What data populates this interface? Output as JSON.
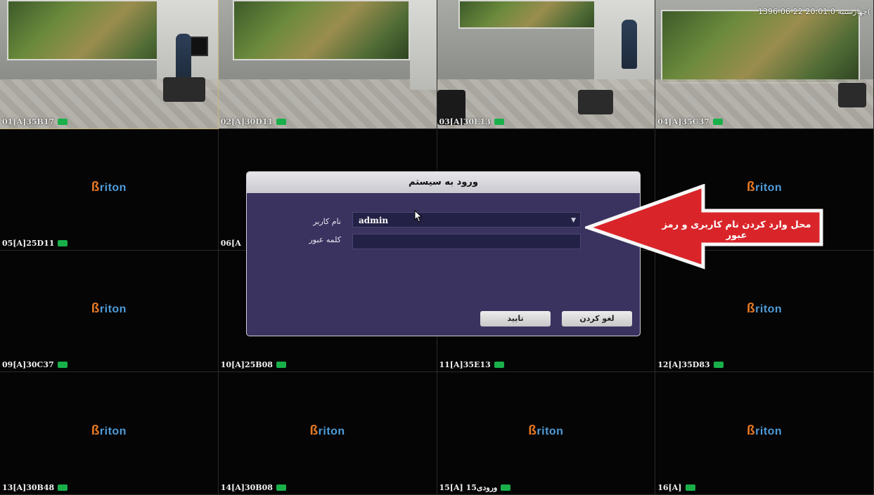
{
  "cameras": [
    {
      "id": "01[A]35B17",
      "feed": true,
      "selected": true
    },
    {
      "id": "02[A]30D11",
      "feed": true
    },
    {
      "id": "03[A]30E13",
      "feed": true
    },
    {
      "id": "04[A]35C37",
      "feed": true,
      "timestamp": "1396-06-22 چهارشنبه 20:01:0("
    },
    {
      "id": "05[A]25D11",
      "logo": "Briton"
    },
    {
      "id": "06[A",
      "logo": ""
    },
    {
      "id": "",
      "logo": ""
    },
    {
      "id": "",
      "logo": "Briton"
    },
    {
      "id": "09[A]30C37",
      "logo": "Briton"
    },
    {
      "id": "10[A]25B08",
      "logo": ""
    },
    {
      "id": "11[A]35E13",
      "logo": ""
    },
    {
      "id": "12[A]35D83",
      "logo": "Briton"
    },
    {
      "id": "13[A]30B48",
      "logo": "Briton"
    },
    {
      "id": "14[A]30B08",
      "logo": "Briton"
    },
    {
      "id": "15[A] ورودی15",
      "logo": "Briton"
    },
    {
      "id": "16[A]",
      "logo": "Briton"
    }
  ],
  "login": {
    "title": "ورود به سیستم",
    "username_label": "نام کاربر",
    "username_value": "admin",
    "password_label": "کلمه عبور",
    "password_value": "",
    "ok_label": "تایید",
    "cancel_label": "لغو کردن"
  },
  "annotation": {
    "text": "محل وارد کردن نام کاربری و رمز عبور",
    "arrow_color": "#d9252a"
  },
  "colors": {
    "status": "#19b04a",
    "dialog_bg": "#3a3360",
    "logo_blue": "#4f9bd8",
    "logo_orange": "#e67822"
  }
}
